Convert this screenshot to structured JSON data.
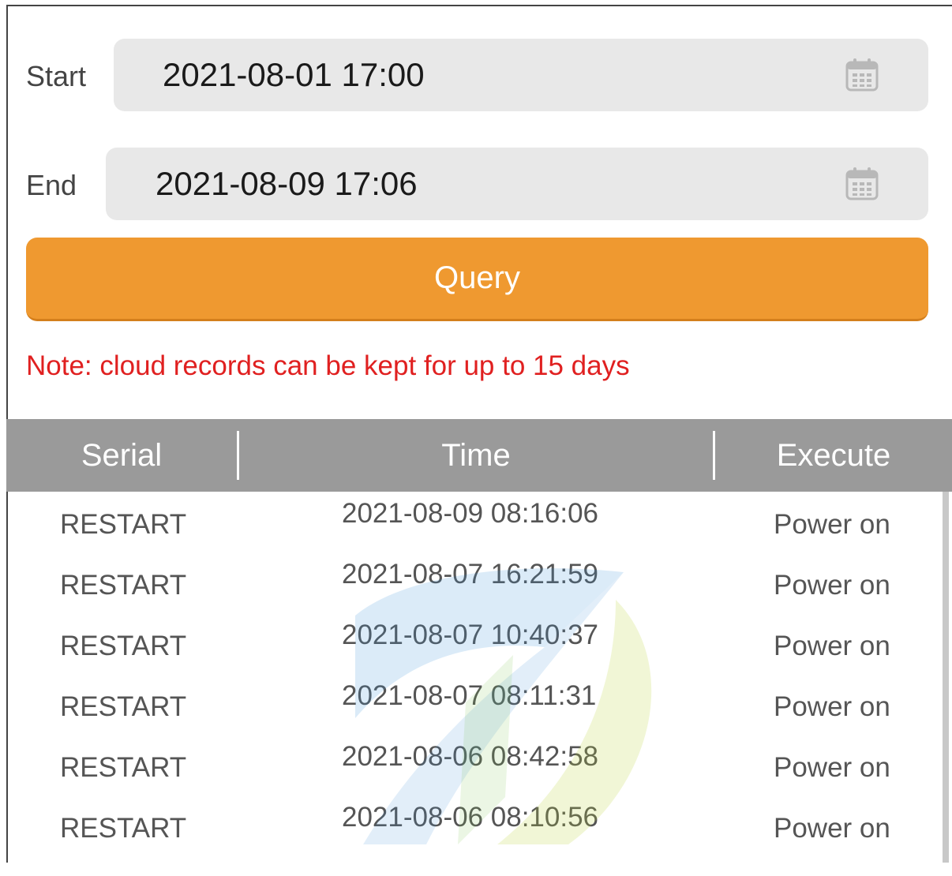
{
  "form": {
    "start_label": "Start",
    "start_value": "2021-08-01 17:00",
    "end_label": "End",
    "end_value": "2021-08-09 17:06",
    "calendar_icon": "calendar-icon",
    "query_label": "Query"
  },
  "note": "Note: cloud records can be kept for up to 15 days",
  "table": {
    "columns": [
      "Serial",
      "Time",
      "Execute"
    ],
    "rows": [
      {
        "serial": "RESTART",
        "time": "2021-08-09 08:16:06",
        "execute": "Power on"
      },
      {
        "serial": "RESTART",
        "time": "2021-08-07 16:21:59",
        "execute": "Power on"
      },
      {
        "serial": "RESTART",
        "time": "2021-08-07 10:40:37",
        "execute": "Power on"
      },
      {
        "serial": "RESTART",
        "time": "2021-08-07 08:11:31",
        "execute": "Power on"
      },
      {
        "serial": "RESTART",
        "time": "2021-08-06 08:42:58",
        "execute": "Power on"
      },
      {
        "serial": "RESTART",
        "time": "2021-08-06 08:10:56",
        "execute": "Power on"
      }
    ]
  },
  "colors": {
    "accent": "#ef9930",
    "note": "#e02020",
    "header_bg": "#9a9a9a",
    "field_bg": "#e8e8e8"
  }
}
